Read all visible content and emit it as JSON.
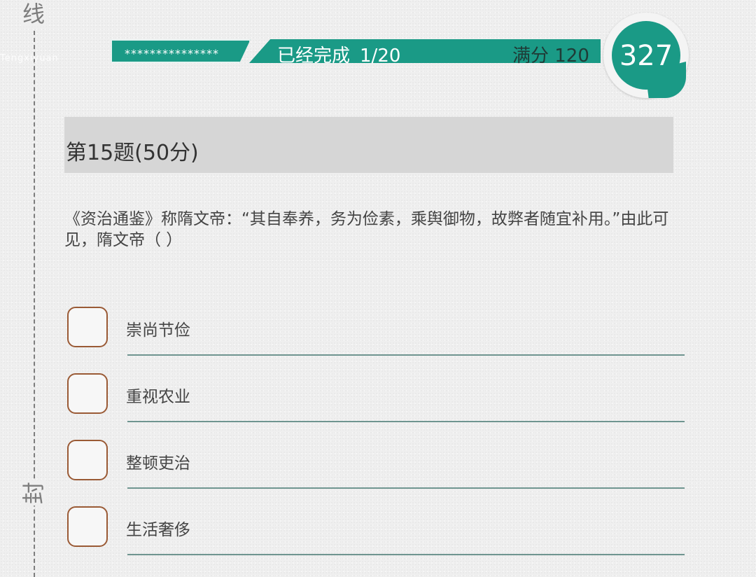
{
  "binding": {
    "top_char": "线",
    "bottom_char": "封",
    "faint_text": "Tengxiyuan"
  },
  "header": {
    "masked_name": "***************",
    "progress_label": "已经完成",
    "progress_count": "1/20",
    "total_score_label": "满分 120"
  },
  "timer": {
    "value": "327"
  },
  "question": {
    "title": "第15题(50分)",
    "text": "《资治通鉴》称隋文帝：“其自奉养，务为俭素，乘舆御物，故弊者随宜补用。”由此可见，隋文帝（ ）"
  },
  "options": [
    {
      "label": "崇尚节俭"
    },
    {
      "label": "重视农业"
    },
    {
      "label": "整顿吏治"
    },
    {
      "label": "生活奢侈"
    }
  ],
  "colors": {
    "accent": "#1a9a86",
    "checkbox_border": "#9a5a35",
    "title_bg": "#d6d6d6",
    "answer_line": "#6f9590"
  }
}
